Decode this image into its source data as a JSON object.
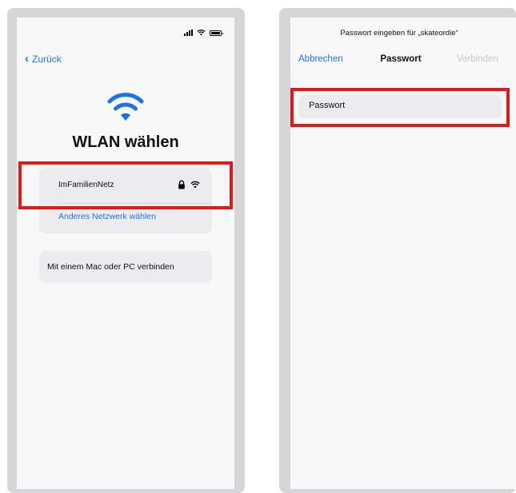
{
  "left_screen": {
    "back_label": "Zurück",
    "title": "WLAN wählen",
    "network_name": "ImFamilienNetz",
    "other_network_label": "Anderes Netzwerk wählen",
    "mac_pc_label": "Mit einem Mac oder PC verbinden",
    "icons": [
      "signal-icon",
      "wifi-icon",
      "battery-icon",
      "wifi-large-icon",
      "lock-icon",
      "wifi-icon"
    ]
  },
  "right_screen": {
    "prompt": "Passwort eingeben für „skateordie“",
    "cancel_label": "Abbrechen",
    "nav_title": "Passwort",
    "connect_label": "Verbinden",
    "password_placeholder": "Passwort"
  },
  "colors": {
    "accent": "#1a73e8",
    "highlight": "#e01919",
    "disabled": "#c6c6c8"
  }
}
